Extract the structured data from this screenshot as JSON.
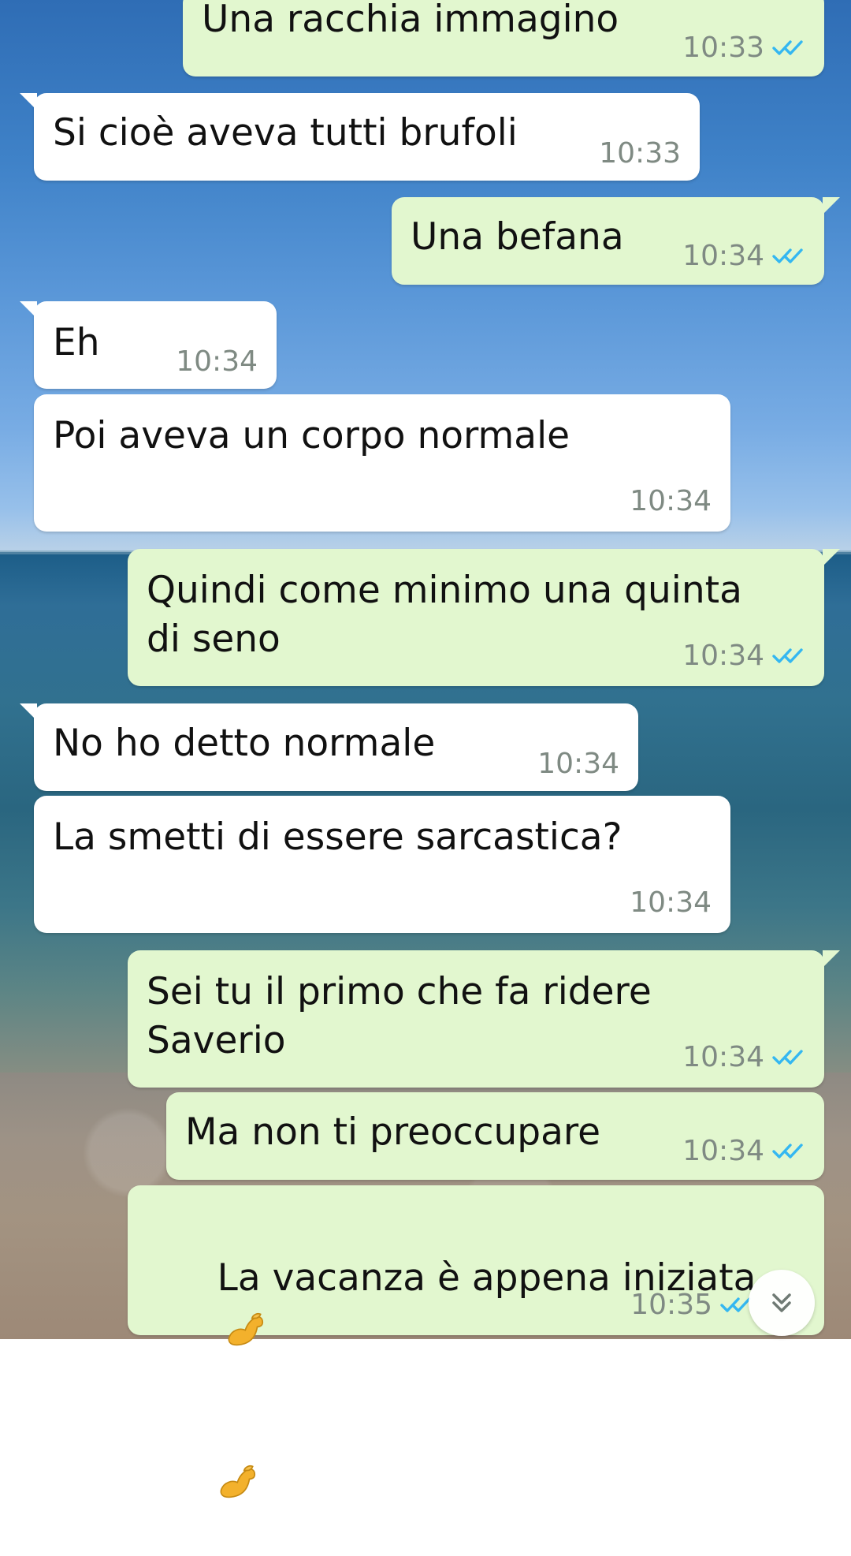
{
  "chat": {
    "messages": [
      {
        "id": "m1",
        "direction": "outgoing",
        "text": "Una racchia immagino",
        "time": "10:33",
        "read": true
      },
      {
        "id": "m2",
        "direction": "incoming",
        "text": "Si cioè aveva tutti brufoli",
        "time": "10:33"
      },
      {
        "id": "m3",
        "direction": "outgoing",
        "text": "Una befana",
        "time": "10:34",
        "read": true
      },
      {
        "id": "m4",
        "direction": "incoming",
        "text": "Eh",
        "time": "10:34"
      },
      {
        "id": "m5",
        "direction": "incoming",
        "text": "Poi aveva un corpo normale",
        "time": "10:34"
      },
      {
        "id": "m6",
        "direction": "outgoing",
        "text": "Quindi come minimo una quinta\ndi seno",
        "time": "10:34",
        "read": true
      },
      {
        "id": "m7",
        "direction": "incoming",
        "text": "No ho detto normale",
        "time": "10:34"
      },
      {
        "id": "m8",
        "direction": "incoming",
        "text": "La smetti di essere sarcastica?",
        "time": "10:34"
      },
      {
        "id": "m9",
        "direction": "outgoing",
        "text": "Sei tu il primo che fa ridere\nSaverio",
        "time": "10:34",
        "read": true
      },
      {
        "id": "m10",
        "direction": "outgoing",
        "text": "Ma non ti preoccupare",
        "time": "10:34",
        "read": true
      },
      {
        "id": "m11",
        "direction": "outgoing",
        "line1": "La vacanza è appena iniziata",
        "emoji": "flexed-biceps-icon",
        "time": "10:35",
        "read": true
      }
    ],
    "scroll_button_icon": "chevron-down-double-icon",
    "read_tick_icon": "double-check-icon",
    "colors": {
      "incoming_bubble": "#ffffff",
      "outgoing_bubble": "#e2f7cf",
      "timestamp": "#7f8a83",
      "read_ticks": "#34b7f1"
    }
  }
}
